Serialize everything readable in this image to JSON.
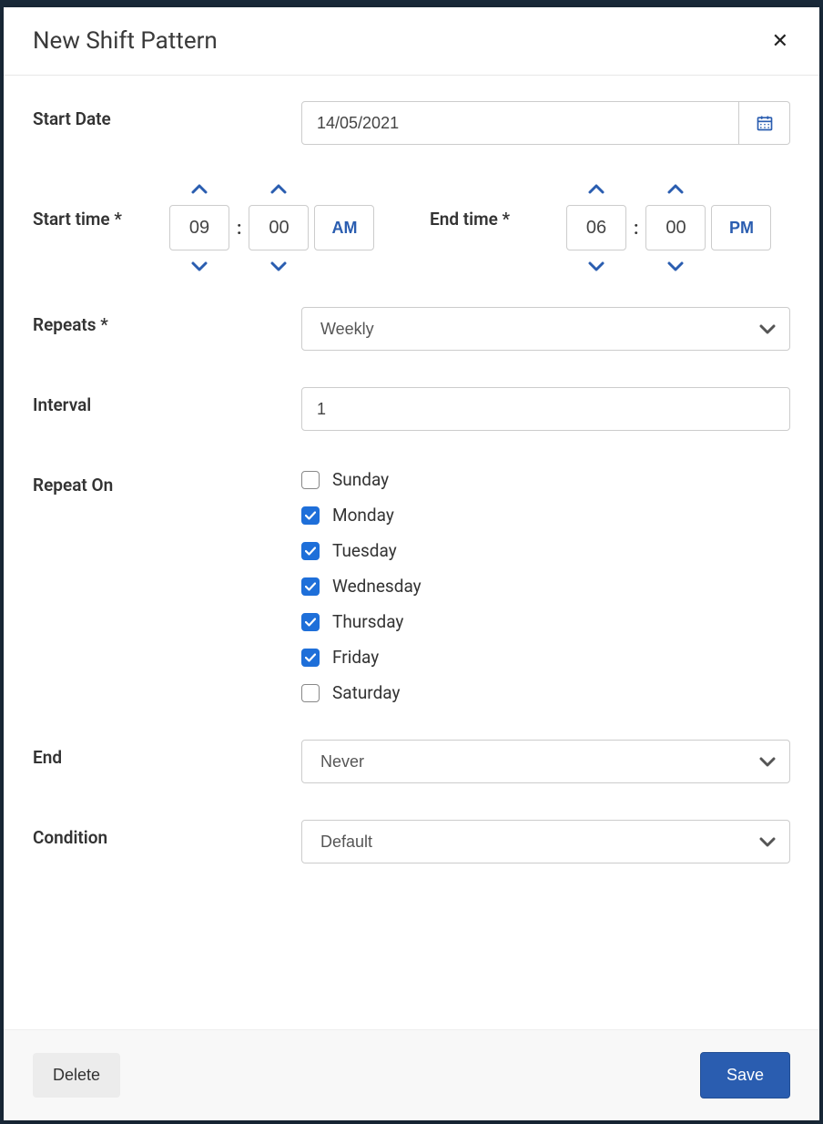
{
  "modal": {
    "title": "New Shift Pattern"
  },
  "start_date": {
    "label": "Start Date",
    "value": "14/05/2021"
  },
  "start_time": {
    "label": "Start time *",
    "hour": "09",
    "minute": "00",
    "ampm": "AM"
  },
  "end_time": {
    "label": "End time *",
    "hour": "06",
    "minute": "00",
    "ampm": "PM"
  },
  "repeats": {
    "label": "Repeats *",
    "value": "Weekly"
  },
  "interval": {
    "label": "Interval",
    "value": "1"
  },
  "repeat_on": {
    "label": "Repeat On",
    "days": [
      {
        "label": "Sunday",
        "checked": false
      },
      {
        "label": "Monday",
        "checked": true
      },
      {
        "label": "Tuesday",
        "checked": true
      },
      {
        "label": "Wednesday",
        "checked": true
      },
      {
        "label": "Thursday",
        "checked": true
      },
      {
        "label": "Friday",
        "checked": true
      },
      {
        "label": "Saturday",
        "checked": false
      }
    ]
  },
  "end": {
    "label": "End",
    "value": "Never"
  },
  "condition": {
    "label": "Condition",
    "value": "Default"
  },
  "footer": {
    "delete": "Delete",
    "save": "Save"
  },
  "colors": {
    "accent": "#2a5db0"
  }
}
